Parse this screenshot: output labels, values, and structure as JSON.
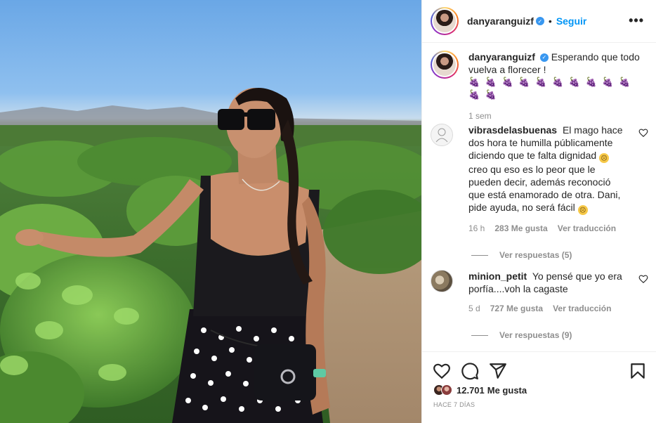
{
  "post": {
    "username": "danyaranguizf",
    "follow_label": "Seguir",
    "more_label": "•••",
    "caption_text": "Esperando que todo vuelva a florecer !",
    "caption_emojis": "🍇 🍇 🍇 🍇 🍇 🍇 🍇 🍇 🍇 🍇 🍇 🍇",
    "caption_time": "1 sem"
  },
  "comments": [
    {
      "username": "vibrasdelasbuenas",
      "text": "El mago hace dos hora te humilla públicamente diciendo que te falta dignidad",
      "text_2": "creo qu eso es lo peor que le pueden decir, además reconoció que está enamorado de otra. Dani, pide ayuda, no será fácil",
      "time": "16 h",
      "likes": "283 Me gusta",
      "translate": "Ver traducción",
      "replies": "Ver respuestas (5)"
    },
    {
      "username": "minion_petit",
      "text": "Yo pensé que yo era porfía....voh la cagaste",
      "time": "5 d",
      "likes": "727 Me gusta",
      "translate": "Ver traducción",
      "replies": "Ver respuestas (9)"
    }
  ],
  "footer": {
    "likes_count": "12.701",
    "likes_label": "Me gusta",
    "time_ago": "HACE 7 DÍAS"
  },
  "icons": [
    "heart-icon",
    "comment-icon",
    "share-icon",
    "bookmark-icon",
    "verified-icon",
    "more-icon"
  ]
}
